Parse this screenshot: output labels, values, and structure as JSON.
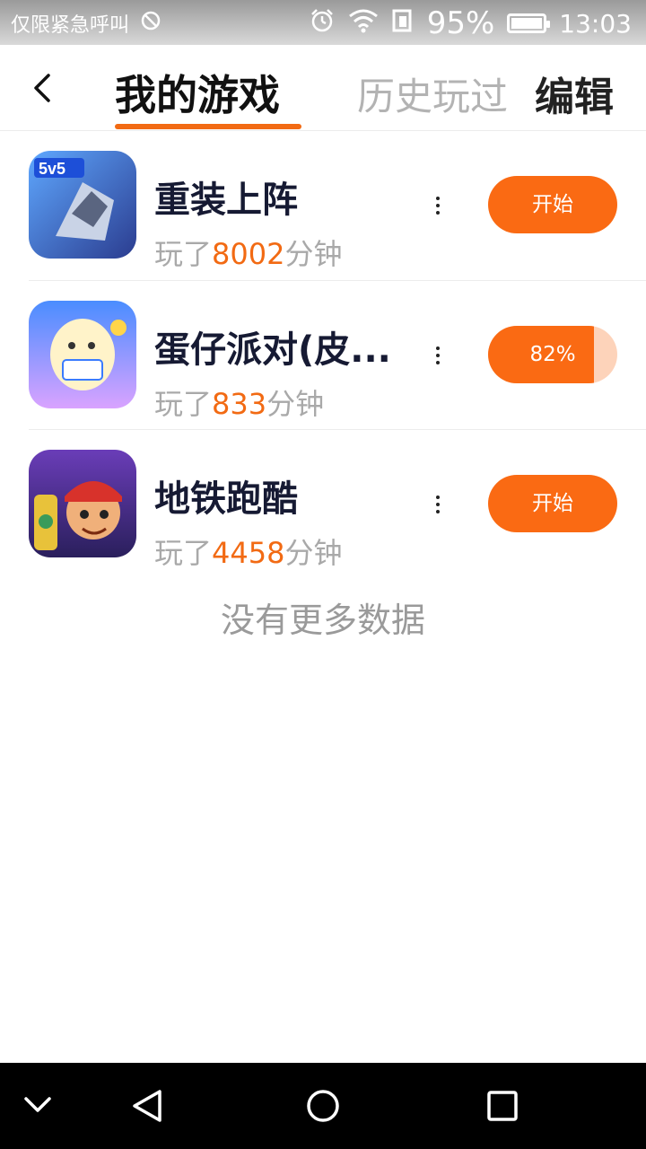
{
  "status_bar": {
    "carrier": "仅限紧急呼叫",
    "battery_percent": "95%",
    "time": "13:03",
    "icons": [
      "no-sim-icon",
      "alarm-icon",
      "wifi-icon",
      "data-icon",
      "battery-icon"
    ]
  },
  "header": {
    "back_icon": "back-chevron-icon",
    "tab_active": "我的游戏",
    "tab_history": "历史玩过",
    "edit": "编辑"
  },
  "colors": {
    "accent": "#fa6a13",
    "accent_light": "#fdd3ba",
    "title": "#161a33",
    "muted": "#a9a9a9"
  },
  "games": [
    {
      "name": "重装上阵",
      "played_prefix": "玩了",
      "minutes": "8002",
      "played_suffix": "分钟",
      "button": "开始",
      "progress": null,
      "icon": "game-icon-mech"
    },
    {
      "name": "蛋仔派对(皮...",
      "played_prefix": "玩了",
      "minutes": "833",
      "played_suffix": "分钟",
      "button": "82%",
      "progress": 0.82,
      "icon": "game-icon-eggy"
    },
    {
      "name": "地铁跑酷",
      "played_prefix": "玩了",
      "minutes": "4458",
      "played_suffix": "分钟",
      "button": "开始",
      "progress": null,
      "icon": "game-icon-subway"
    }
  ],
  "footer_text": "没有更多数据",
  "nav_bar": {
    "icons": [
      "collapse-icon",
      "back-triangle-icon",
      "home-circle-icon",
      "recents-square-icon"
    ]
  }
}
